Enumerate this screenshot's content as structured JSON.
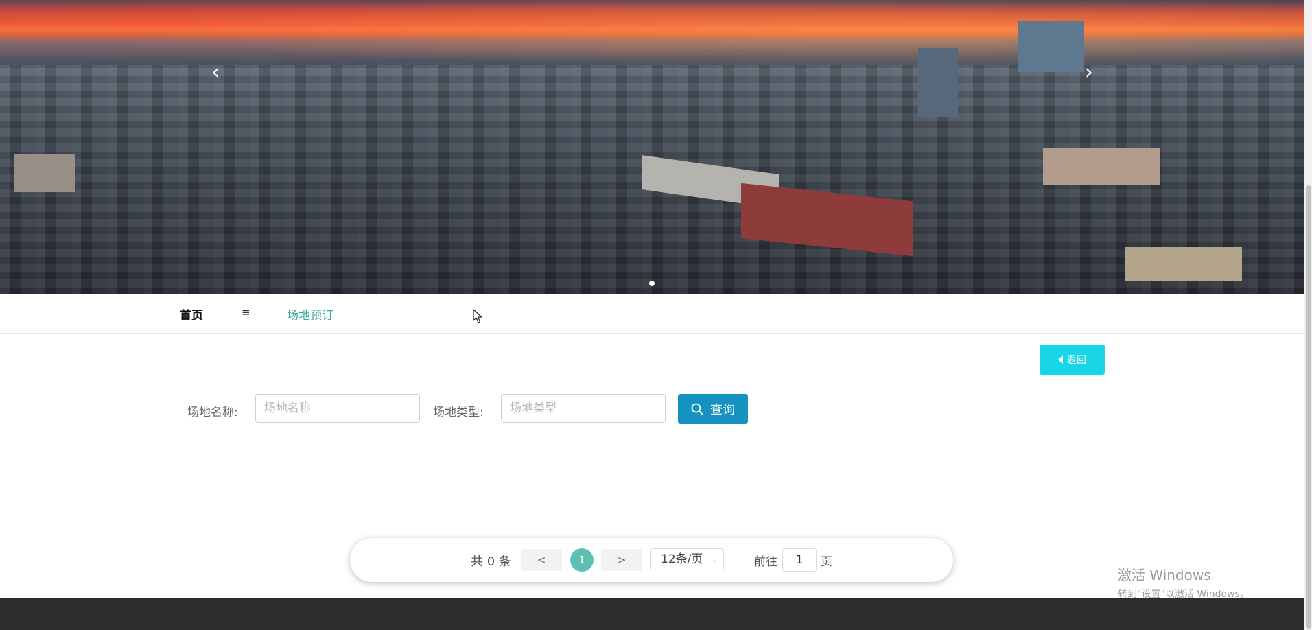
{
  "nav": {
    "home": "首页",
    "separator": "≡",
    "current": "场地预订"
  },
  "actions": {
    "back_label": "返回"
  },
  "search": {
    "name_label": "场地名称:",
    "name_placeholder": "场地名称",
    "type_label": "场地类型:",
    "type_placeholder": "场地类型",
    "query_label": "查询"
  },
  "pagination": {
    "total_text": "共 0 条",
    "prev": "<",
    "next": ">",
    "current_page": "1",
    "page_size": "12条/页",
    "goto_label": "前往",
    "goto_value": "1",
    "goto_suffix": "页"
  },
  "watermark": {
    "line1": "激活 Windows",
    "line2": "转到\"设置\"以激活 Windows。"
  },
  "colors": {
    "back_button": "#19d6e6",
    "search_button": "#1592bf",
    "active_page": "#5fbfb2",
    "nav_current": "#3aa9a0",
    "footer": "#2c2c2c"
  }
}
